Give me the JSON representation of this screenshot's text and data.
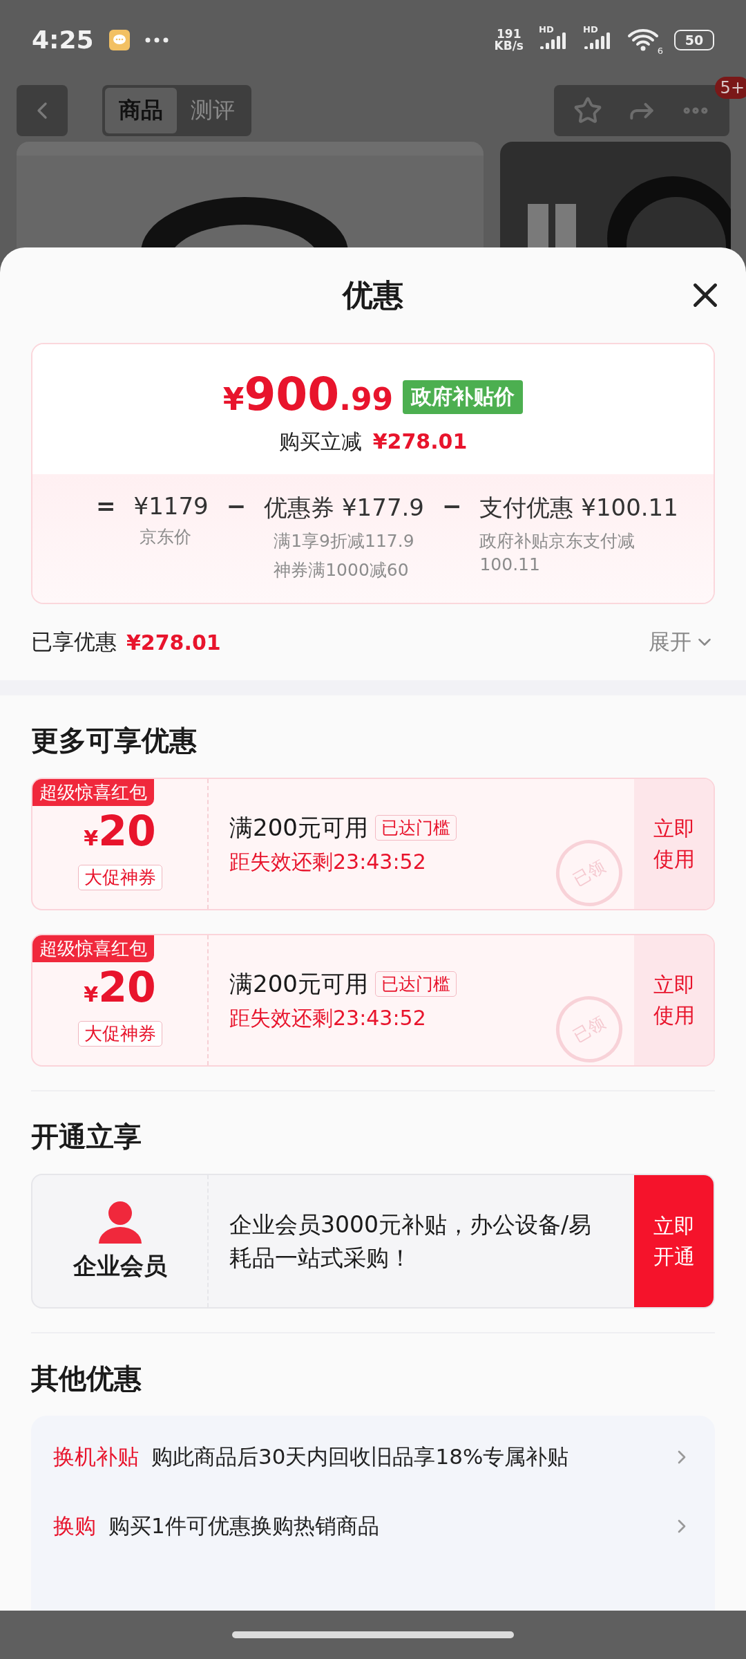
{
  "status_bar": {
    "time": "4:25",
    "net_speed_value": "191",
    "net_speed_unit": "KB/s",
    "signals": [
      {
        "label": "HD"
      },
      {
        "label": "HD"
      }
    ],
    "wifi_label": "6",
    "battery": "50"
  },
  "nav": {
    "tabs": [
      {
        "label": "商品",
        "selected": true
      },
      {
        "label": "测评",
        "selected": false
      }
    ],
    "badge": "5+"
  },
  "sheet": {
    "title": "优惠",
    "price_card": {
      "currency": "¥",
      "price_integer": "900",
      "price_decimal": ".99",
      "price_badge": "政府补贴价",
      "saving_label": "购买立减",
      "saving_amount": "¥278.01",
      "breakdown": [
        {
          "operator": "=",
          "amount": "¥1179",
          "notes": [
            "京东价"
          ]
        },
        {
          "operator": "−",
          "label": "优惠券",
          "amount": "¥177.9",
          "notes": [
            "满1享9折减117.9",
            "神券满1000减60"
          ]
        },
        {
          "operator": "−",
          "label": "支付优惠",
          "amount": "¥100.11",
          "notes": [
            "政府补贴京东支付减100.11"
          ]
        }
      ]
    },
    "enjoyed": {
      "label": "已享优惠",
      "amount": "¥278.01",
      "expand": "展开"
    },
    "more": {
      "heading": "更多可享优惠",
      "coupons": [
        {
          "tag": "超级惊喜红包",
          "currency": "¥",
          "amount": "20",
          "type": "大促神券",
          "condition": "满200元可用",
          "status": "已达门槛",
          "countdown": "距失效还剩23:43:52",
          "action": "立即使用",
          "stamp": "已领"
        },
        {
          "tag": "超级惊喜红包",
          "currency": "¥",
          "amount": "20",
          "type": "大促神券",
          "condition": "满200元可用",
          "status": "已达门槛",
          "countdown": "距失效还剩23:43:52",
          "action": "立即使用",
          "stamp": "已领"
        }
      ]
    },
    "open": {
      "heading": "开通立享",
      "member": {
        "name": "企业会员",
        "text": "企业会员3000元补贴，办公设备/易耗品一站式采购！",
        "action": "立即开通"
      }
    },
    "other": {
      "heading": "其他优惠",
      "items": [
        {
          "tag": "换机补贴",
          "text": "购此商品后30天内回收旧品享18%专属补贴"
        },
        {
          "tag": "换购",
          "text": "购买1件可优惠换购热销商品"
        }
      ]
    }
  }
}
